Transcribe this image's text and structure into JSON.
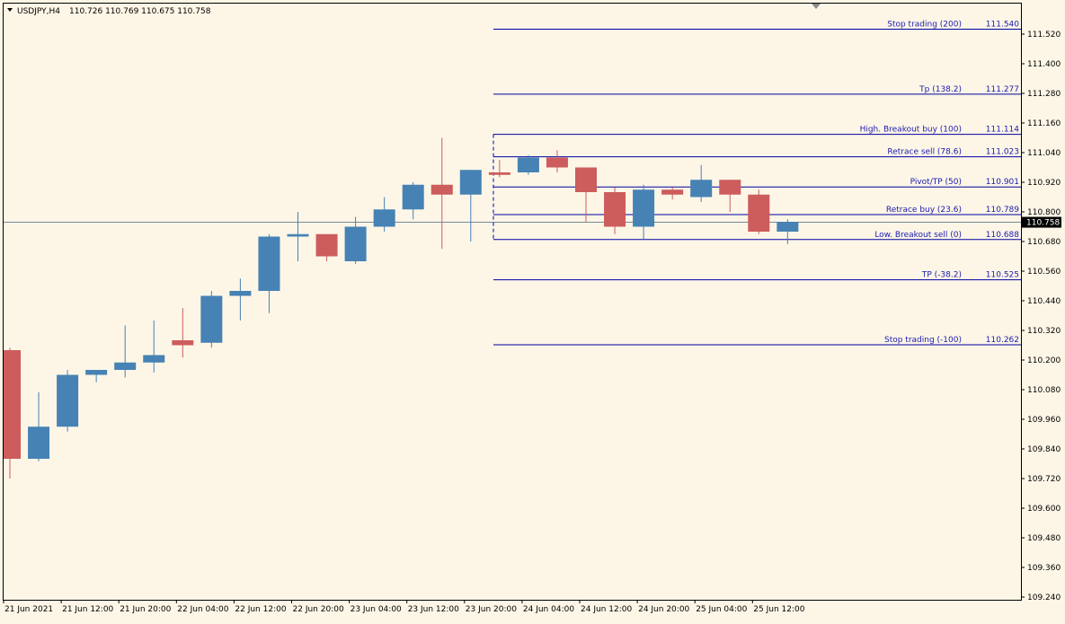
{
  "header": {
    "symbol_timeframe": "USDJPY,H4",
    "ohlc": "110.726 110.769 110.675 110.758"
  },
  "colors": {
    "background": "#fdf6e7",
    "bull": "#4682b4",
    "bear": "#cd5c5c",
    "fib_line": "#0000a0",
    "bid_line": "#778899",
    "axis": "#000000",
    "price_tag_bg": "#000000",
    "price_tag_fg": "#ffffff"
  },
  "chart_data": {
    "type": "candlestick",
    "symbol": "USDJPY",
    "timeframe": "H4",
    "ylim": [
      109.24,
      111.6
    ],
    "current_price": 110.758,
    "y_ticks": [
      "111.520",
      "111.400",
      "111.280",
      "111.160",
      "111.040",
      "110.920",
      "110.800",
      "110.680",
      "110.560",
      "110.440",
      "110.320",
      "110.200",
      "110.080",
      "109.960",
      "109.840",
      "109.720",
      "109.600",
      "109.480",
      "109.360",
      "109.240"
    ],
    "x_ticks": [
      "21 Jun 2021",
      "21 Jun 12:00",
      "21 Jun 20:00",
      "22 Jun 04:00",
      "22 Jun 12:00",
      "22 Jun 20:00",
      "23 Jun 04:00",
      "23 Jun 12:00",
      "23 Jun 20:00",
      "24 Jun 04:00",
      "24 Jun 12:00",
      "24 Jun 20:00",
      "25 Jun 04:00",
      "25 Jun 12:00"
    ],
    "candles": [
      {
        "o": 110.24,
        "h": 110.25,
        "l": 109.72,
        "c": 109.8
      },
      {
        "o": 109.8,
        "h": 110.07,
        "l": 109.79,
        "c": 109.93
      },
      {
        "o": 109.93,
        "h": 110.16,
        "l": 109.91,
        "c": 110.14
      },
      {
        "o": 110.14,
        "h": 110.16,
        "l": 110.11,
        "c": 110.16
      },
      {
        "o": 110.16,
        "h": 110.34,
        "l": 110.13,
        "c": 110.19
      },
      {
        "o": 110.19,
        "h": 110.36,
        "l": 110.15,
        "c": 110.22
      },
      {
        "o": 110.28,
        "h": 110.41,
        "l": 110.21,
        "c": 110.26
      },
      {
        "o": 110.27,
        "h": 110.48,
        "l": 110.25,
        "c": 110.46
      },
      {
        "o": 110.46,
        "h": 110.53,
        "l": 110.36,
        "c": 110.48
      },
      {
        "o": 110.48,
        "h": 110.71,
        "l": 110.39,
        "c": 110.7
      },
      {
        "o": 110.7,
        "h": 110.8,
        "l": 110.6,
        "c": 110.71
      },
      {
        "o": 110.71,
        "h": 110.71,
        "l": 110.6,
        "c": 110.62
      },
      {
        "o": 110.6,
        "h": 110.78,
        "l": 110.59,
        "c": 110.74
      },
      {
        "o": 110.74,
        "h": 110.86,
        "l": 110.72,
        "c": 110.81
      },
      {
        "o": 110.81,
        "h": 110.92,
        "l": 110.77,
        "c": 110.91
      },
      {
        "o": 110.91,
        "h": 111.1,
        "l": 110.65,
        "c": 110.87
      },
      {
        "o": 110.87,
        "h": 110.97,
        "l": 110.68,
        "c": 110.97
      },
      {
        "o": 110.96,
        "h": 111.01,
        "l": 110.94,
        "c": 110.95
      },
      {
        "o": 110.96,
        "h": 111.03,
        "l": 110.95,
        "c": 111.02
      },
      {
        "o": 111.02,
        "h": 111.05,
        "l": 110.96,
        "c": 110.98
      },
      {
        "o": 110.98,
        "h": 110.98,
        "l": 110.76,
        "c": 110.88
      },
      {
        "o": 110.88,
        "h": 110.9,
        "l": 110.71,
        "c": 110.74
      },
      {
        "o": 110.74,
        "h": 110.91,
        "l": 110.69,
        "c": 110.89
      },
      {
        "o": 110.89,
        "h": 110.9,
        "l": 110.85,
        "c": 110.87
      },
      {
        "o": 110.86,
        "h": 110.99,
        "l": 110.84,
        "c": 110.93
      },
      {
        "o": 110.93,
        "h": 110.93,
        "l": 110.8,
        "c": 110.87
      },
      {
        "o": 110.87,
        "h": 110.89,
        "l": 110.71,
        "c": 110.72
      },
      {
        "o": 110.72,
        "h": 110.77,
        "l": 110.67,
        "c": 110.76
      }
    ],
    "fib_levels": [
      {
        "label": "Stop trading (200)",
        "price": "111.540"
      },
      {
        "label": "Tp (138.2)",
        "price": "111.277"
      },
      {
        "label": "High. Breakout buy (100)",
        "price": "111.114"
      },
      {
        "label": "Retrace sell (78.6)",
        "price": "111.023"
      },
      {
        "label": "Pivot/TP (50)",
        "price": "110.901"
      },
      {
        "label": "Retrace buy (23.6)",
        "price": "110.789"
      },
      {
        "label": "Low. Breakout sell (0)",
        "price": "110.688"
      },
      {
        "label": "TP (-38.2)",
        "price": "110.525"
      },
      {
        "label": "Stop trading (-100)",
        "price": "110.262"
      }
    ]
  }
}
